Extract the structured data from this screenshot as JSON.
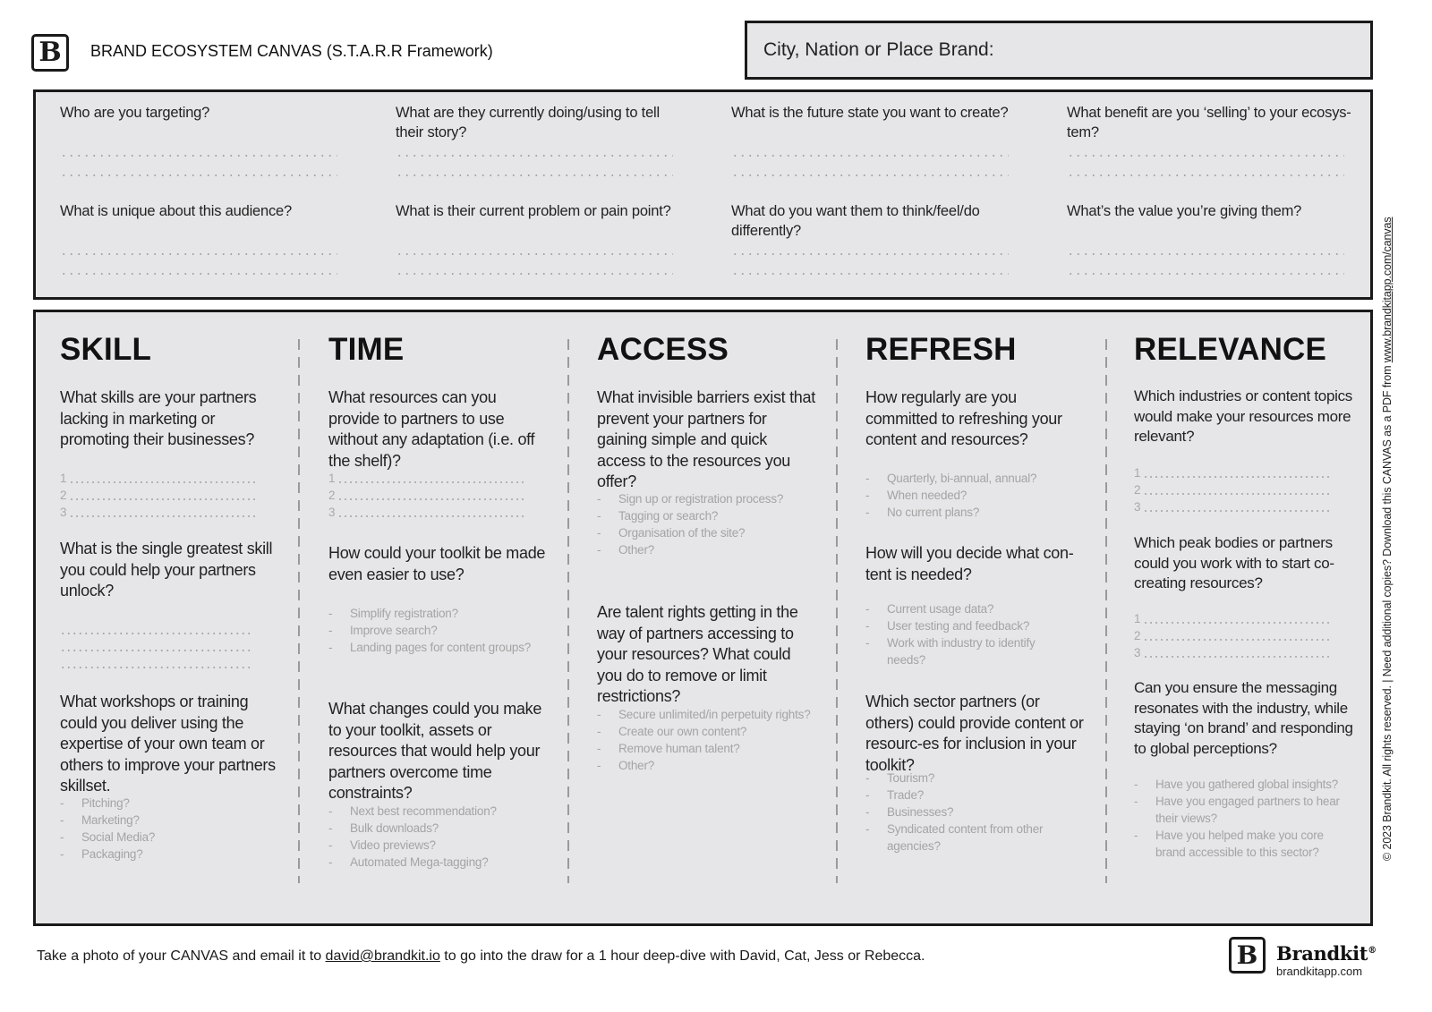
{
  "header": {
    "title": "BRAND ECOSYSTEM CANVAS (S.T.A.R.R Framework)",
    "logo_letter": "B",
    "brand_field_label": "City, Nation or Place Brand:"
  },
  "audience": {
    "questions": [
      "Who are you targeting?",
      "What are they currently doing/using to tell their story?",
      "What is the future state you want to create?",
      "What benefit are you ‘selling’ to your ecosys-tem?",
      "What is unique about this audience?",
      "What is their current problem or pain point?",
      "What do you want them to think/feel/do differently?",
      "What’s the value you’re giving them?"
    ]
  },
  "columns": [
    {
      "title": "SKILL",
      "q1": "What skills are your partners lacking in marketing or promoting their businesses?",
      "numbers": [
        "1",
        "2",
        "3"
      ],
      "q2": "What is the single greatest skill you could help your partners unlock?",
      "q3": "What workshops or training could you deliver using the expertise of your own team or others to improve your partners skillset.",
      "hints3": [
        "Pitching?",
        "Marketing?",
        "Social Media?",
        "Packaging?"
      ]
    },
    {
      "title": "TIME",
      "q1": "What resources can you provide to partners to use without any adaptation (i.e. off the shelf)?",
      "numbers": [
        "1",
        "2",
        "3"
      ],
      "q2": "How could your toolkit be made even easier to use?",
      "hints2": [
        "Simplify registration?",
        "Improve search?",
        "Landing pages for content groups?"
      ],
      "q3": "What changes could you make to your toolkit, assets or resources that would help your partners overcome time constraints?",
      "hints3": [
        "Next best recommendation?",
        "Bulk downloads?",
        "Video previews?",
        "Automated Mega-tagging?"
      ]
    },
    {
      "title": "ACCESS",
      "q1": "What invisible barriers exist that prevent your partners for gaining simple and quick access to the resources you offer?",
      "hints1": [
        "Sign up or registration process?",
        "Tagging or search?",
        "Organisation of the site?",
        "Other?"
      ],
      "q2": "Are talent rights getting in the way of partners accessing to your resources? What could you do to remove or limit restrictions?",
      "hints2": [
        "Secure unlimited/in perpetuity rights?",
        "Create our own content?",
        "Remove human talent?",
        "Other?"
      ]
    },
    {
      "title": "REFRESH",
      "q1": "How regularly are you committed to refreshing your content and resources?",
      "hints1": [
        "Quarterly, bi-annual, annual?",
        "When needed?",
        "No current plans?"
      ],
      "q2": "How will you decide what con-tent is needed?",
      "hints2": [
        "Current usage data?",
        "User testing and feedback?",
        "Work with  industry to identify needs?"
      ],
      "q3": "Which sector partners (or others) could provide content or resourc-es for inclusion in your toolkit?",
      "hints3": [
        "Tourism?",
        "Trade?",
        "Businesses?",
        "Syndicated content from other agencies?"
      ]
    },
    {
      "title": "RELEVANCE",
      "q1": "Which industries or content topics would make your resources more relevant?",
      "numbers": [
        "1",
        "2",
        "3"
      ],
      "q2": "Which peak bodies or partners could you work with to start co-creating resources?",
      "q3": "Can you ensure the messaging resonates with the industry, while staying ‘on brand’ and responding to global perceptions?",
      "hints3": [
        "Have you gathered global insights?",
        "Have you engaged partners to hear their views?",
        "Have you helped make you core brand accessible to this sector?"
      ]
    }
  ],
  "side_note": {
    "text": "© 2023 Brandkit. All rights reserved. | Need additional copies? Download this CANVAS as a PDF from ",
    "url": "www.brandkitapp.com/canvas"
  },
  "footer": {
    "text_before": "Take a photo of your CANVAS and email it to ",
    "email": "david@brandkit.io",
    "text_after": " to go into the draw for a 1 hour deep-dive with David, Cat, Jess or Rebecca.",
    "brand_name": "Brandkit",
    "brand_reg": "®",
    "brand_url": "brandkitapp.com"
  }
}
